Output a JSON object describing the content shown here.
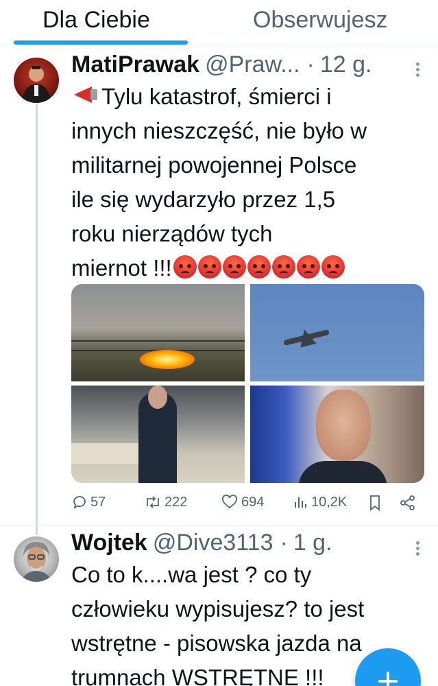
{
  "tabs": [
    {
      "label": "Dla Ciebie",
      "active": true
    },
    {
      "label": "Obserwujesz",
      "active": false
    }
  ],
  "tweets": [
    {
      "name": "MatiPrawak",
      "handle": "@Praw...",
      "separator": "·",
      "time": "12 g.",
      "text_lines": [
        "Tylu katastrof, śmierci i",
        "innych nieszczęść, nie było w",
        "militarnej powojennej Polsce",
        "ile się wydarzyło przez 1,5",
        "roku nierządów tych",
        "miernot !!!"
      ],
      "leading_emoji": "megaphone-emoji",
      "trailing_emoji": "angry-face-emoji",
      "trailing_emoji_count": 7,
      "media": [
        "explosion-photo",
        "fighter-jet-photo",
        "meeting-room-photo",
        "man-portrait-photo"
      ],
      "actions": {
        "replies": "57",
        "retweets": "222",
        "likes": "694",
        "views": "10,2K"
      }
    },
    {
      "name": "Wojtek",
      "handle": "@Dive3113",
      "separator": "·",
      "time": "1 g.",
      "text_lines": [
        "Co to k....wa jest ? co ty",
        "człowieku wypisujesz?  to jest",
        "wstrętne - pisowska jazda na",
        "trumnach WSTRĘTNE !!!"
      ]
    }
  ],
  "colors": {
    "accent": "#1d9bf0",
    "text": "#0f1419",
    "muted": "#536471",
    "divider": "#e6ecf0"
  }
}
